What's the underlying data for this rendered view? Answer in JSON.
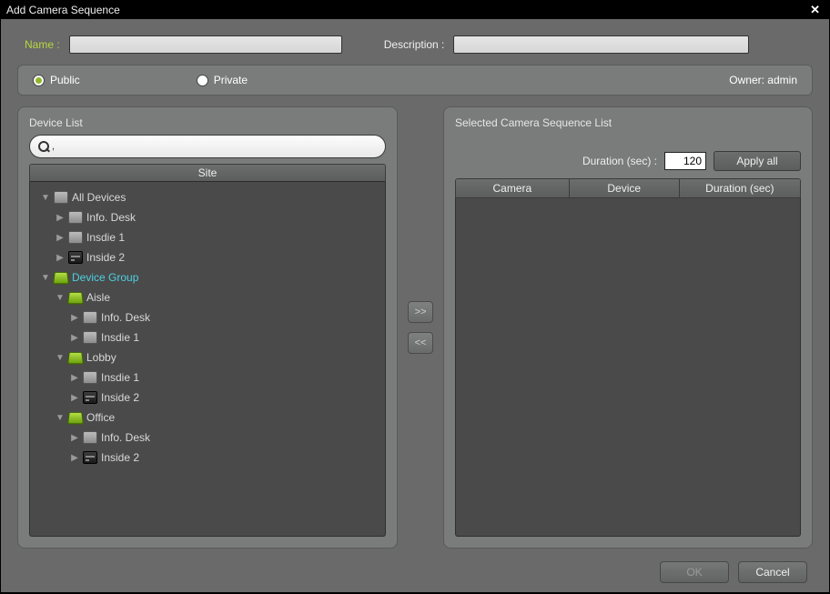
{
  "title": "Add Camera Sequence",
  "inputs": {
    "name_label": "Name :",
    "name_value": "",
    "desc_label": "Description :",
    "desc_value": ""
  },
  "visibility": {
    "public": "Public",
    "private": "Private",
    "selected": "public",
    "owner_label": "Owner: admin"
  },
  "left_panel": {
    "title": "Device List",
    "search_placeholder": "",
    "site_header": "Site"
  },
  "tree": [
    {
      "level": 1,
      "expand": "expanded",
      "icon": "box",
      "label": "All Devices",
      "sel": false
    },
    {
      "level": 2,
      "expand": "collapsed",
      "icon": "box",
      "label": "Info. Desk",
      "sel": false
    },
    {
      "level": 2,
      "expand": "collapsed",
      "icon": "box",
      "label": "Insdie 1",
      "sel": false
    },
    {
      "level": 2,
      "expand": "collapsed",
      "icon": "dvr",
      "label": "Inside 2",
      "sel": false
    },
    {
      "level": 1,
      "expand": "expanded",
      "icon": "green",
      "label": "Device Group",
      "sel": true
    },
    {
      "level": 2,
      "expand": "expanded",
      "icon": "green",
      "label": "Aisle",
      "sel": false
    },
    {
      "level": 3,
      "expand": "collapsed",
      "icon": "box",
      "label": "Info. Desk",
      "sel": false
    },
    {
      "level": 3,
      "expand": "collapsed",
      "icon": "box",
      "label": "Insdie 1",
      "sel": false
    },
    {
      "level": 2,
      "expand": "expanded",
      "icon": "green",
      "label": "Lobby",
      "sel": false
    },
    {
      "level": 3,
      "expand": "collapsed",
      "icon": "box",
      "label": "Insdie 1",
      "sel": false
    },
    {
      "level": 3,
      "expand": "collapsed",
      "icon": "dvr",
      "label": "Inside 2",
      "sel": false
    },
    {
      "level": 2,
      "expand": "expanded",
      "icon": "green",
      "label": "Office",
      "sel": false
    },
    {
      "level": 3,
      "expand": "collapsed",
      "icon": "box",
      "label": "Info. Desk",
      "sel": false
    },
    {
      "level": 3,
      "expand": "collapsed",
      "icon": "dvr",
      "label": "Inside 2",
      "sel": false
    }
  ],
  "mid": {
    "add": ">>",
    "remove": "<<"
  },
  "right_panel": {
    "title": "Selected Camera Sequence List",
    "dur_label": "Duration (sec) :",
    "dur_value": "120",
    "apply": "Apply all",
    "col_camera": "Camera",
    "col_device": "Device",
    "col_duration": "Duration (sec)"
  },
  "footer": {
    "ok": "OK",
    "cancel": "Cancel"
  }
}
